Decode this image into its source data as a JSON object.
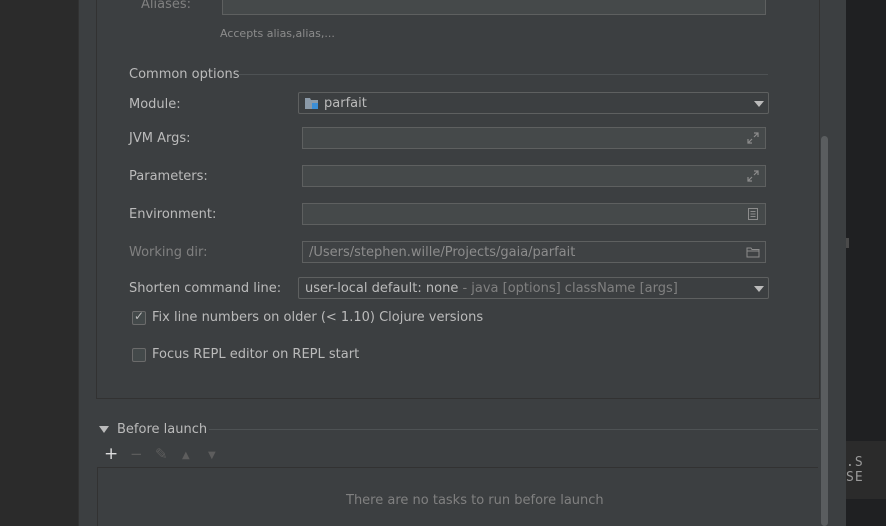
{
  "aliases": {
    "label": "Aliases:",
    "hint": "Accepts alias,alias,..."
  },
  "common_options": {
    "title": "Common options"
  },
  "module": {
    "label": "Module:",
    "value": "parfait",
    "icon": "module-folder-icon"
  },
  "jvm_args": {
    "label": "JVM Args:",
    "value": "",
    "icon": "expand-icon"
  },
  "parameters": {
    "label": "Parameters:",
    "value": "",
    "icon": "expand-icon"
  },
  "environment": {
    "label": "Environment:",
    "value": "",
    "icon": "document-icon"
  },
  "working_dir": {
    "label": "Working dir:",
    "value": "/Users/stephen.wille/Projects/gaia/parfait",
    "icon": "folder-icon"
  },
  "shorten_cmd": {
    "label": "Shorten command line:",
    "value": "user-local default: none",
    "detail": " - java [options] className [args]"
  },
  "fix_line_numbers": {
    "label": "Fix line numbers on older (< 1.10) Clojure versions",
    "checked": true
  },
  "focus_repl": {
    "label": "Focus REPL editor on REPL start",
    "checked": false
  },
  "before_launch": {
    "title": "Before launch",
    "toolbar": {
      "add": "+",
      "remove": "−",
      "edit": "✎",
      "up": "▲",
      "down": "▼"
    },
    "empty_text": "There are no tasks to run before launch"
  },
  "background_editor": {
    "glyphs": ".S  SE"
  },
  "colors": {
    "dialog_bg": "#3c3f41",
    "field_bg": "#45494a",
    "text": "#bbbbbb",
    "disabled_text": "#808080"
  }
}
